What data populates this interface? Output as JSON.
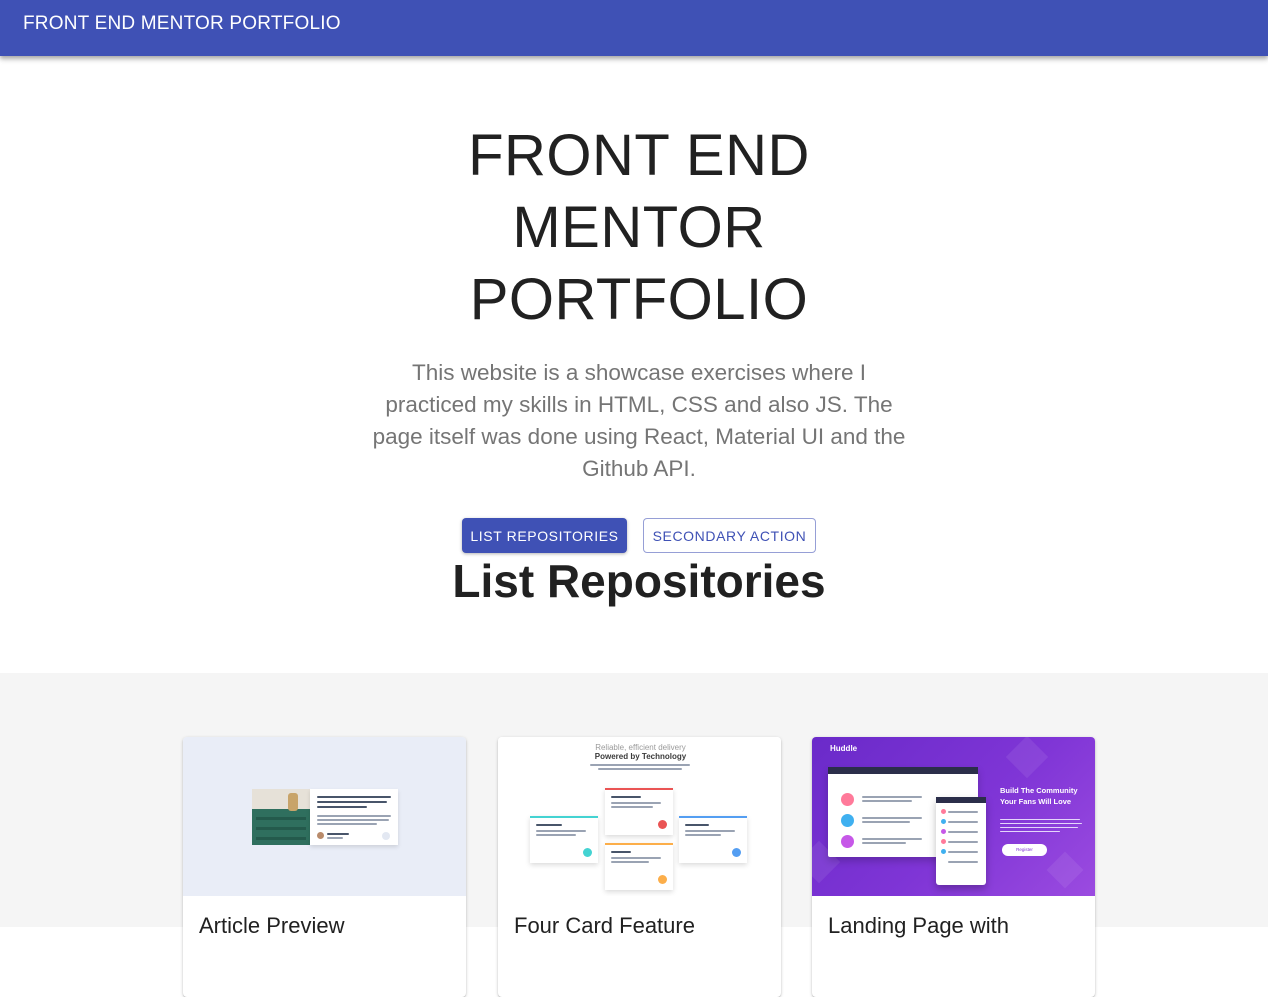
{
  "appbar": {
    "title": "FRONT END MENTOR PORTFOLIO"
  },
  "hero": {
    "title": "FRONT END MENTOR PORTFOLIO",
    "description": "This website is a showcase exercises where I practiced my skills in HTML, CSS and also JS. The page itself was done using React, Material UI and the Github API.",
    "primary_button": "LIST REPOSITORIES",
    "secondary_button": "SECONDARY ACTION"
  },
  "repositories": {
    "heading": "List Repositories",
    "cards": [
      {
        "title": "Article Preview"
      },
      {
        "title": "Four Card Feature",
        "preview_subtitle": "Reliable, efficient delivery",
        "preview_heading": "Powered by Technology"
      },
      {
        "title": "Landing Page with",
        "preview_logo": "Huddle",
        "preview_heading": "Build The Community Your Fans Will Love",
        "preview_button": "Register"
      }
    ]
  },
  "colors": {
    "primary": "#3f51b5",
    "background": "#ffffff",
    "section_background": "#f5f5f5"
  }
}
